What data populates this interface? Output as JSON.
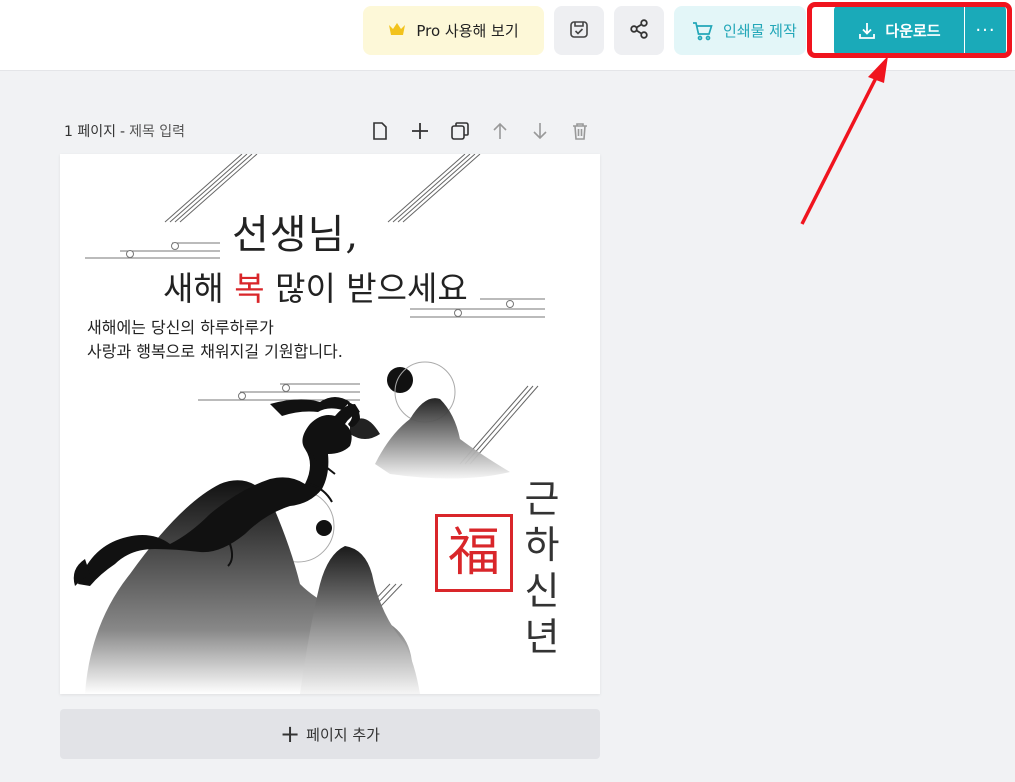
{
  "toolbar": {
    "pro_label": "Pro 사용해 보기",
    "print_label": "인쇄물 제작",
    "download_label": "다운로드",
    "more_label": "···",
    "accent_color": "#1aaab9",
    "highlight_color": "#f0141e",
    "icons": [
      "crown-icon",
      "save-check-icon",
      "share-icon",
      "cart-icon",
      "download-icon"
    ]
  },
  "page": {
    "number_label": "1 페이지",
    "separator": "-",
    "title_placeholder": "제목 입력",
    "tools": [
      "page-icon",
      "plus-icon",
      "duplicate-icon",
      "arrow-up-icon",
      "arrow-down-icon",
      "trash-icon"
    ]
  },
  "card": {
    "title_line1": "선생님,",
    "title_line2_pre": "새해 ",
    "title_line2_red": "복",
    "title_line2_post": " 많이 받으세요",
    "body_line1": "새해에는 당신의 하루하루가",
    "body_line2": "사랑과 행복으로 채워지길 기원합니다.",
    "seal_char": "福",
    "vertical": [
      "근",
      "하",
      "신",
      "년"
    ],
    "red_color": "#d9262a"
  },
  "add_page": {
    "plus": "+",
    "label": "페이지 추가"
  }
}
